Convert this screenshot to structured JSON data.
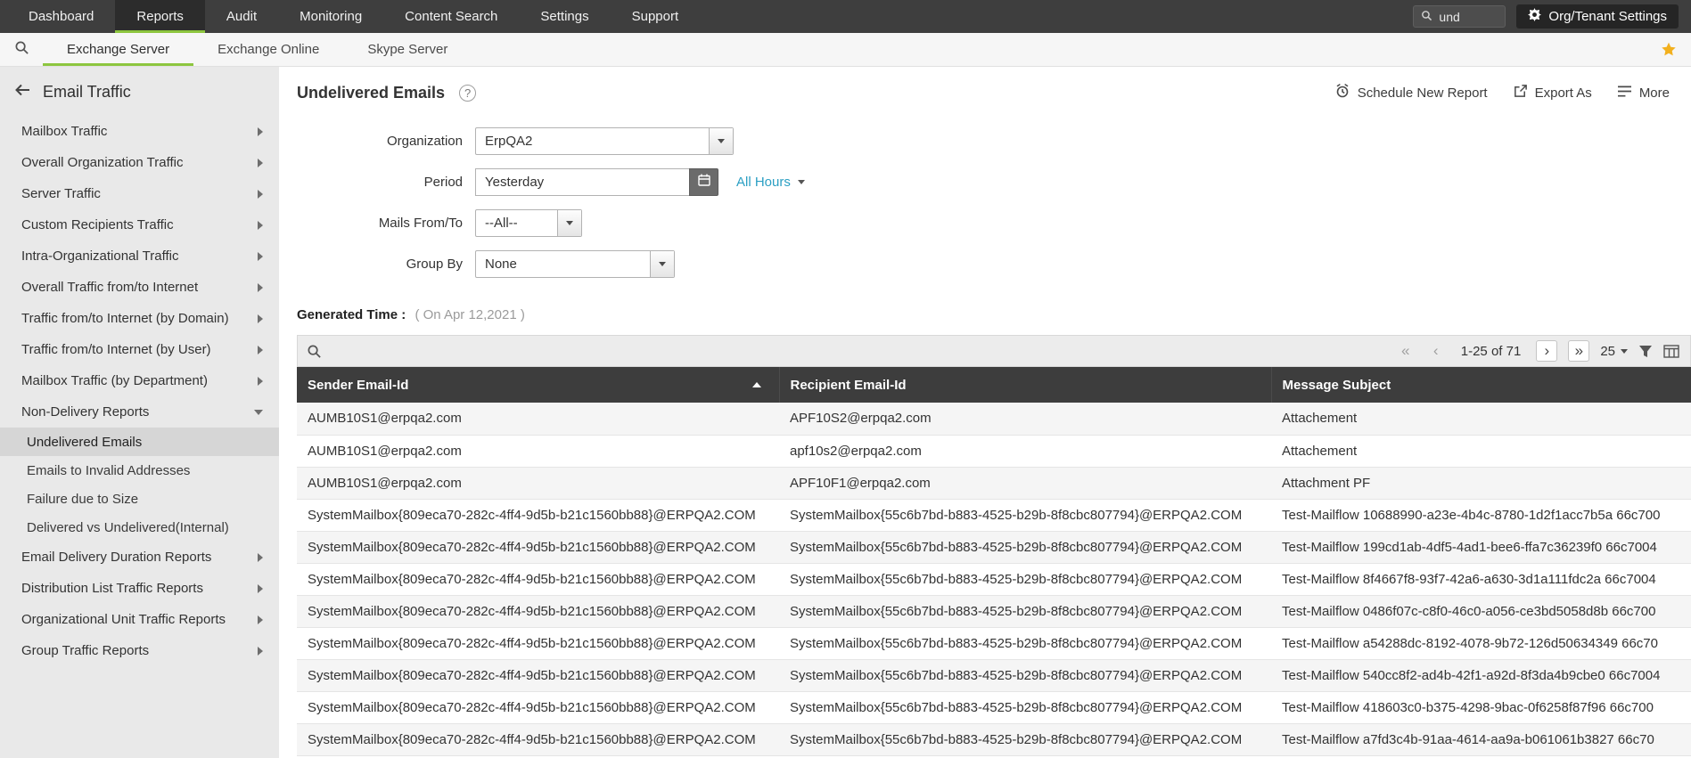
{
  "colors": {
    "accent": "#8dc63f",
    "table_header_bg": "#3d3d3d",
    "link": "#2b9fc3",
    "topnav_bg": "#3e3e3e"
  },
  "topnav": {
    "tabs": [
      {
        "label": "Dashboard",
        "active": false
      },
      {
        "label": "Reports",
        "active": true
      },
      {
        "label": "Audit",
        "active": false
      },
      {
        "label": "Monitoring",
        "active": false
      },
      {
        "label": "Content Search",
        "active": false
      },
      {
        "label": "Settings",
        "active": false
      },
      {
        "label": "Support",
        "active": false
      }
    ],
    "search": {
      "value": "und"
    },
    "org_settings_label": "Org/Tenant Settings"
  },
  "subnav": {
    "tabs": [
      {
        "label": "Exchange Server",
        "active": true
      },
      {
        "label": "Exchange Online",
        "active": false
      },
      {
        "label": "Skype Server",
        "active": false
      }
    ]
  },
  "sidebar": {
    "title": "Email Traffic",
    "items": [
      {
        "label": "Mailbox Traffic",
        "type": "group",
        "state": "collapsed"
      },
      {
        "label": "Overall Organization Traffic",
        "type": "group",
        "state": "collapsed"
      },
      {
        "label": "Server Traffic",
        "type": "group",
        "state": "collapsed"
      },
      {
        "label": "Custom Recipients Traffic",
        "type": "group",
        "state": "collapsed"
      },
      {
        "label": "Intra-Organizational Traffic",
        "type": "group",
        "state": "collapsed"
      },
      {
        "label": "Overall Traffic from/to Internet",
        "type": "group",
        "state": "collapsed"
      },
      {
        "label": "Traffic from/to Internet (by Domain)",
        "type": "group",
        "state": "collapsed"
      },
      {
        "label": "Traffic from/to Internet (by User)",
        "type": "group",
        "state": "collapsed"
      },
      {
        "label": "Mailbox Traffic (by Department)",
        "type": "group",
        "state": "collapsed"
      },
      {
        "label": "Non-Delivery Reports",
        "type": "group",
        "state": "expanded"
      },
      {
        "label": "Undelivered Emails",
        "type": "subitem",
        "selected": true
      },
      {
        "label": "Emails to Invalid Addresses",
        "type": "subitem",
        "selected": false
      },
      {
        "label": "Failure due to Size",
        "type": "subitem",
        "selected": false
      },
      {
        "label": "Delivered vs Undelivered(Internal)",
        "type": "subitem",
        "selected": false
      },
      {
        "label": "Email Delivery Duration Reports",
        "type": "group",
        "state": "collapsed"
      },
      {
        "label": "Distribution List Traffic Reports",
        "type": "group",
        "state": "collapsed"
      },
      {
        "label": "Organizational Unit Traffic Reports",
        "type": "group",
        "state": "collapsed"
      },
      {
        "label": "Group Traffic Reports",
        "type": "group",
        "state": "collapsed"
      }
    ]
  },
  "report": {
    "title": "Undelivered Emails",
    "actions": {
      "schedule": "Schedule New Report",
      "export": "Export As",
      "more": "More"
    },
    "form": {
      "organization": {
        "label": "Organization",
        "value": "ErpQA2"
      },
      "period": {
        "label": "Period",
        "value": "Yesterday",
        "hours_filter": "All Hours"
      },
      "mails_from_to": {
        "label": "Mails From/To",
        "value": "--All--"
      },
      "group_by": {
        "label": "Group By",
        "value": "None"
      }
    },
    "generated_time": {
      "label": "Generated Time :",
      "value": "( On Apr 12,2021 )"
    }
  },
  "table": {
    "pagination": {
      "range": "1-25 of 71",
      "page_size": "25"
    },
    "columns": [
      {
        "label": "Sender Email-Id",
        "sort": "asc"
      },
      {
        "label": "Recipient Email-Id",
        "sort": "none"
      },
      {
        "label": "Message Subject",
        "sort": "none"
      }
    ],
    "rows": [
      [
        "AUMB10S1@erpqa2.com",
        "APF10S2@erpqa2.com",
        "Attachement"
      ],
      [
        "AUMB10S1@erpqa2.com",
        "apf10s2@erpqa2.com",
        "Attachement"
      ],
      [
        "AUMB10S1@erpqa2.com",
        "APF10F1@erpqa2.com",
        "Attachment PF"
      ],
      [
        "SystemMailbox{809eca70-282c-4ff4-9d5b-b21c1560bb88}@ERPQA2.COM",
        "SystemMailbox{55c6b7bd-b883-4525-b29b-8f8cbc807794}@ERPQA2.COM",
        "Test-Mailflow 10688990-a23e-4b4c-8780-1d2f1acc7b5a 66c700"
      ],
      [
        "SystemMailbox{809eca70-282c-4ff4-9d5b-b21c1560bb88}@ERPQA2.COM",
        "SystemMailbox{55c6b7bd-b883-4525-b29b-8f8cbc807794}@ERPQA2.COM",
        "Test-Mailflow 199cd1ab-4df5-4ad1-bee6-ffa7c36239f0 66c7004"
      ],
      [
        "SystemMailbox{809eca70-282c-4ff4-9d5b-b21c1560bb88}@ERPQA2.COM",
        "SystemMailbox{55c6b7bd-b883-4525-b29b-8f8cbc807794}@ERPQA2.COM",
        "Test-Mailflow 8f4667f8-93f7-42a6-a630-3d1a111fdc2a 66c7004"
      ],
      [
        "SystemMailbox{809eca70-282c-4ff4-9d5b-b21c1560bb88}@ERPQA2.COM",
        "SystemMailbox{55c6b7bd-b883-4525-b29b-8f8cbc807794}@ERPQA2.COM",
        "Test-Mailflow 0486f07c-c8f0-46c0-a056-ce3bd5058d8b 66c700"
      ],
      [
        "SystemMailbox{809eca70-282c-4ff4-9d5b-b21c1560bb88}@ERPQA2.COM",
        "SystemMailbox{55c6b7bd-b883-4525-b29b-8f8cbc807794}@ERPQA2.COM",
        "Test-Mailflow a54288dc-8192-4078-9b72-126d50634349 66c70"
      ],
      [
        "SystemMailbox{809eca70-282c-4ff4-9d5b-b21c1560bb88}@ERPQA2.COM",
        "SystemMailbox{55c6b7bd-b883-4525-b29b-8f8cbc807794}@ERPQA2.COM",
        "Test-Mailflow 540cc8f2-ad4b-42f1-a92d-8f3da4b9cbe0 66c7004"
      ],
      [
        "SystemMailbox{809eca70-282c-4ff4-9d5b-b21c1560bb88}@ERPQA2.COM",
        "SystemMailbox{55c6b7bd-b883-4525-b29b-8f8cbc807794}@ERPQA2.COM",
        "Test-Mailflow 418603c0-b375-4298-9bac-0f6258f87f96 66c700"
      ],
      [
        "SystemMailbox{809eca70-282c-4ff4-9d5b-b21c1560bb88}@ERPQA2.COM",
        "SystemMailbox{55c6b7bd-b883-4525-b29b-8f8cbc807794}@ERPQA2.COM",
        "Test-Mailflow a7fd3c4b-91aa-4614-aa9a-b061061b3827 66c70"
      ]
    ]
  }
}
